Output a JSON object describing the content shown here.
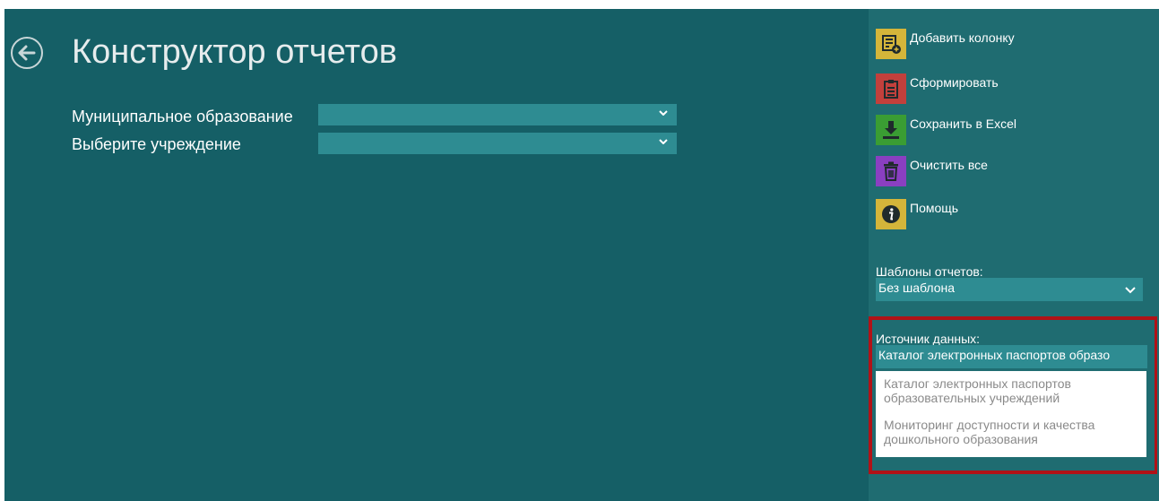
{
  "header": {
    "title": "Конструктор отчетов",
    "back_icon": "arrow-left-circle-icon"
  },
  "form": {
    "municipality_label": "Муниципальное образование",
    "municipality_value": "",
    "institution_label": "Выберите учреждение",
    "institution_value": ""
  },
  "actions": [
    {
      "label": "Добавить колонку",
      "icon": "add-column-icon",
      "color": "#d4b53a"
    },
    {
      "label": "Сформировать",
      "icon": "clipboard-icon",
      "color": "#c2403c"
    },
    {
      "label": "Сохранить в Excel",
      "icon": "download-icon",
      "color": "#3a9d33"
    },
    {
      "label": "Очистить все",
      "icon": "trash-icon",
      "color": "#8a3fc1"
    },
    {
      "label": "Помощь",
      "icon": "info-icon",
      "color": "#d4b53a"
    }
  ],
  "templates": {
    "label": "Шаблоны отчетов:",
    "value": "Без шаблона"
  },
  "datasource": {
    "label": "Источник данных:",
    "value": "Каталог электронных паспортов образо",
    "options": [
      "Каталог электронных паспортов образовательных учреждений",
      "Мониторинг доступности и качества дошкольного образования"
    ]
  },
  "colors": {
    "main_bg": "#155f66",
    "side_bg": "#1f6c71",
    "select_bg": "#2e8c92",
    "highlight": "#b01217"
  }
}
